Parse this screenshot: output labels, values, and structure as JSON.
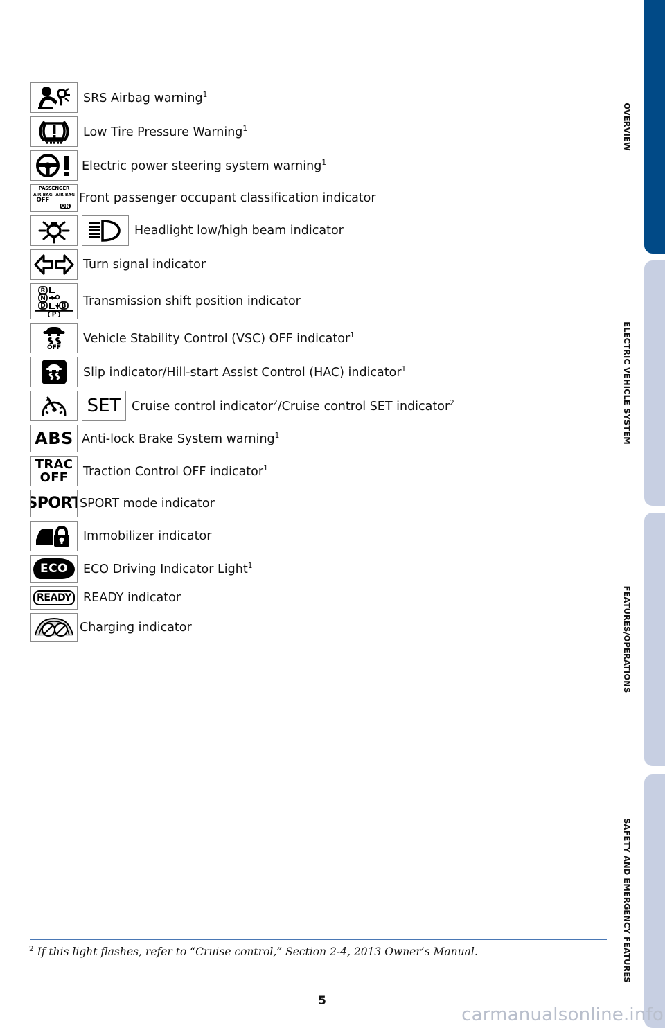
{
  "page": {
    "number": "5",
    "watermark": "carmanualsonline.info",
    "footnote_marker": "2",
    "footnote_text": "If this light flashes, refer to “Cruise control,” Section 2-4, 2013 Owner’s Manual."
  },
  "colors": {
    "active_tab": "#014a87",
    "inactive_tab": "#c7cfe2",
    "rule": "#4a78b5",
    "watermark": "#b9bfcc",
    "icon_border": "#8a8a8a"
  },
  "side_tabs": [
    {
      "label": "OVERVIEW",
      "state": "active"
    },
    {
      "label": "ELECTRIC VEHICLE SYSTEM",
      "state": "inactive"
    },
    {
      "label": "FEATURES/OPERATIONS",
      "state": "inactive"
    },
    {
      "label": "SAFETY AND EMERGENCY FEATURES",
      "state": "inactive"
    }
  ],
  "rows": [
    {
      "icons": [
        "srs-airbag-icon"
      ],
      "text": "SRS Airbag warning",
      "sup": "1"
    },
    {
      "icons": [
        "low-tire-pressure-icon"
      ],
      "text": "Low Tire Pressure Warning",
      "sup": "1"
    },
    {
      "icons": [
        "electric-power-steering-icon"
      ],
      "text": "Electric power steering system warning",
      "sup": "1"
    },
    {
      "icons": [
        "front-passenger-airbag-icon"
      ],
      "text": "Front passenger occupant classification indicator",
      "sup": "",
      "icon_text": {
        "title": "PASSENGER",
        "left_top": "AIR BAG",
        "left_bottom": "OFF",
        "right_top": "AIR BAG",
        "right_bottom": "ON"
      }
    },
    {
      "icons": [
        "headlight-low-beam-icon",
        "headlight-high-beam-icon"
      ],
      "text": "Headlight low/high beam indicator",
      "sup": ""
    },
    {
      "icons": [
        "turn-signal-icon"
      ],
      "text": "Turn signal indicator",
      "sup": ""
    },
    {
      "icons": [
        "transmission-shift-icon"
      ],
      "text": "Transmission shift position indicator",
      "sup": "",
      "icon_text": {
        "r": "R",
        "n": "N",
        "d": "D",
        "b": "B",
        "p": "P"
      }
    },
    {
      "icons": [
        "vsc-off-icon"
      ],
      "text": "Vehicle Stability Control (VSC) OFF indicator",
      "sup": "1",
      "icon_text": {
        "off": "OFF"
      }
    },
    {
      "icons": [
        "slip-hac-icon"
      ],
      "text": "Slip indicator/Hill-start Assist Control (HAC) indicator",
      "sup": "1"
    },
    {
      "icons": [
        "cruise-control-icon",
        "cruise-set-icon"
      ],
      "text": "Cruise control indicator",
      "sup": "2",
      "text2": "/Cruise control SET indicator",
      "sup2": "2",
      "icon_text": {
        "set": "SET"
      }
    },
    {
      "icons": [
        "abs-icon"
      ],
      "text": "Anti-lock Brake System warning",
      "sup": "1",
      "icon_text": {
        "abs": "ABS"
      }
    },
    {
      "icons": [
        "trac-off-icon"
      ],
      "text": "Traction Control OFF indicator",
      "sup": "1",
      "icon_text": {
        "trac": "TRAC",
        "off": "OFF"
      }
    },
    {
      "icons": [
        "sport-mode-icon"
      ],
      "text": "SPORT mode indicator",
      "sup": "",
      "icon_text": {
        "sport": "SPORT"
      }
    },
    {
      "icons": [
        "immobilizer-icon"
      ],
      "text": "Immobilizer indicator",
      "sup": ""
    },
    {
      "icons": [
        "eco-driving-icon"
      ],
      "text": "ECO Driving Indicator Light",
      "sup": "1",
      "icon_text": {
        "eco": "ECO"
      }
    },
    {
      "icons": [
        "ready-icon"
      ],
      "text": "READY indicator",
      "sup": "",
      "icon_text": {
        "ready": "READY"
      }
    },
    {
      "icons": [
        "charging-icon"
      ],
      "text": "Charging indicator",
      "sup": ""
    }
  ]
}
